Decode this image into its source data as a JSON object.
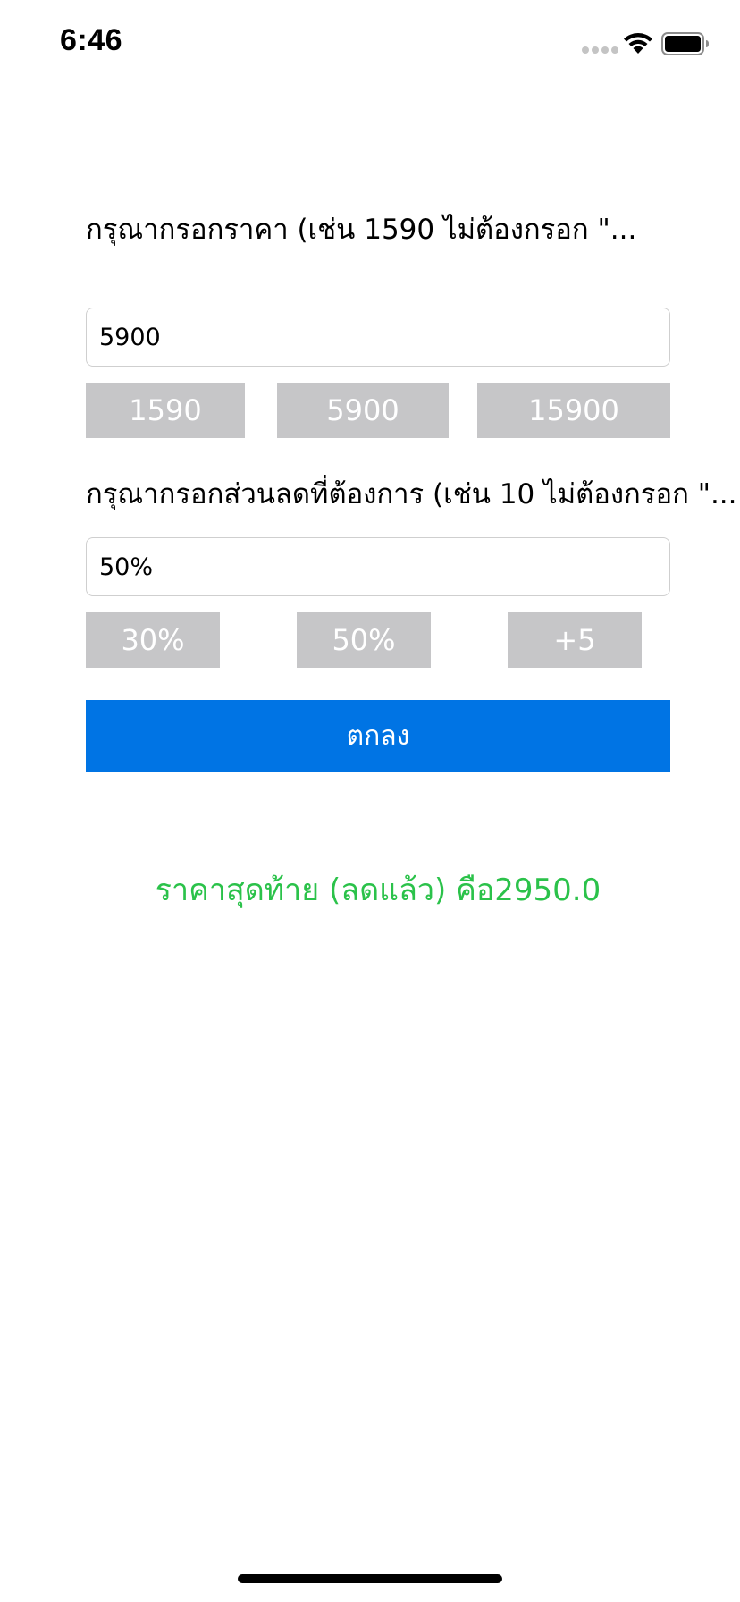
{
  "status_bar": {
    "time": "6:46"
  },
  "price_section": {
    "prompt": "กรุณากรอกราคา (เช่น 1590 ไม่ต้องกรอก \"...",
    "input_value": "5900",
    "presets": [
      "1590",
      "5900",
      "15900"
    ]
  },
  "discount_section": {
    "prompt": "กรุณากรอกส่วนลดที่ต้องการ (เช่น 10 ไม่ต้องกรอก \"...",
    "input_value": "50%",
    "presets": [
      "30%",
      "50%",
      "+5"
    ]
  },
  "submit": {
    "label": "ตกลง"
  },
  "result": {
    "text": "ราคาสุดท้าย (ลดแล้ว) คือ2950.0"
  },
  "colors": {
    "accent": "#0074e4",
    "preset_background": "#c6c6c8",
    "result_text": "#2bc24a"
  },
  "icons": [
    "signal-icon",
    "wifi-icon",
    "battery-icon"
  ]
}
